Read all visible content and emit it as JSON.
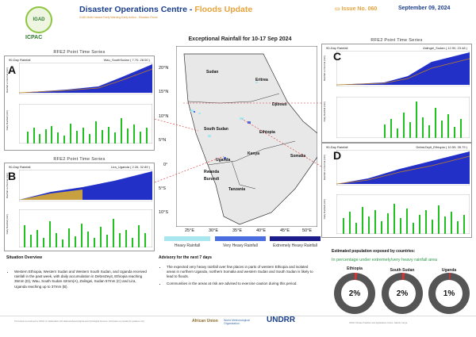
{
  "header": {
    "title_main": "Disaster Operations Centre",
    "title_sep": " - ",
    "title_sub": "Floods Update",
    "subtitle": "IGAD Multi-Hazard Early Warning Early Action - Situation Room",
    "issue": "Issue No. 060",
    "date": "September 09, 2024",
    "logo_text": "IGAD",
    "org": "ICPAC"
  },
  "map": {
    "title": "Exceptional Rainfall for 10-17 Sep 2024",
    "lat_ticks": [
      "20°N",
      "15°N",
      "10°N",
      "5°N",
      "0°",
      "5°S",
      "10°S"
    ],
    "lon_ticks": [
      "25°E",
      "30°E",
      "35°E",
      "40°E",
      "45°E",
      "50°E"
    ],
    "countries": [
      "Sudan",
      "Eritrea",
      "Djibouti",
      "South Sudan",
      "Ethiopia",
      "Somalia",
      "Kenya",
      "Uganda",
      "Rwanda",
      "Burundi",
      "Tanzania"
    ],
    "legend": [
      {
        "label": "Heavy Rainfall",
        "color": "#a8e6f0"
      },
      {
        "label": "Very Heavy Rainfall",
        "color": "#4a6de0"
      },
      {
        "label": "Extremely Heavy Rainfall",
        "color": "#1b1b8a"
      }
    ]
  },
  "panels": [
    {
      "id": "A",
      "title": "RFE2 Point Time Series",
      "left": "90-Day Rainfall",
      "right": "Wau_SouthSudan ( 7.70, 28.00 )"
    },
    {
      "id": "B",
      "title": "RFE2 Point Time Series",
      "left": "90-Day Rainfall",
      "right": "Lira_Uganda ( 2.26, 32.89 )"
    },
    {
      "id": "C",
      "title": "RFE2 Point Time Series",
      "left": "90-Day Rainfall",
      "right": "Zalingei_Sudan ( 12.90, 23.48 )"
    },
    {
      "id": "D",
      "title": "RFE2 Point Time Series",
      "left": "90-Day Rainfall",
      "right": "DebreZeyit_Ethiopia ( 10.59, 35.79 )"
    }
  ],
  "y_label_top": "Rainfall vs Normal (mm)",
  "y_label_bottom": "Daily Rainfall (mm)",
  "situation": {
    "heading": "Situation Overview",
    "bullets": [
      "Western Ethiopia, Western Sudan and Western South Sudan, and Uganda received rainfall in the past week, with daily accumulation in DebreZeyit, Ethiopia reaching 35mm (D), Wau, South Sudan 42mm(A), Zalingei, Sudan 57mm (C) and Lira, Uganda reaching up to 37mm (B)."
    ]
  },
  "advisory": {
    "heading": "Advisory for the next 7 days",
    "bullets": [
      "The expected very heavy rainfall over few places in parts of western Ethiopia and isolated areas in northern Uganda, northern Somalia and western Sudan and South Sudan is likely to lead to floods.",
      "Communities in the areas at risk are advised to exercise caution during this period."
    ]
  },
  "population": {
    "heading": "Estimated population exposed by countries:",
    "subheading": "In percentage under extremely/very heavy rainfall area",
    "countries": [
      {
        "name": "Ethiopia",
        "value": "2%",
        "pct": 2
      },
      {
        "name": "South Sudan",
        "value": "2%",
        "pct": 2
      },
      {
        "name": "Uganda",
        "value": "1%",
        "pct": 1
      }
    ]
  },
  "footer": {
    "left": "This bulletin is produced by ICPAC in collaboration with National Meteorological and Hydrological Services. Information is provided for guidance only.",
    "right": "ICPAC Climate Prediction and Applications Centre, Nairobi, Kenya",
    "partners": [
      "African Union",
      "World Meteorological Organization",
      "UNDRR"
    ]
  },
  "colors": {
    "blue": "#1a3e8c",
    "orange": "#e8a33a",
    "green": "#2d7a2d",
    "donut": "#555555",
    "donut_accent": "#e03030"
  }
}
